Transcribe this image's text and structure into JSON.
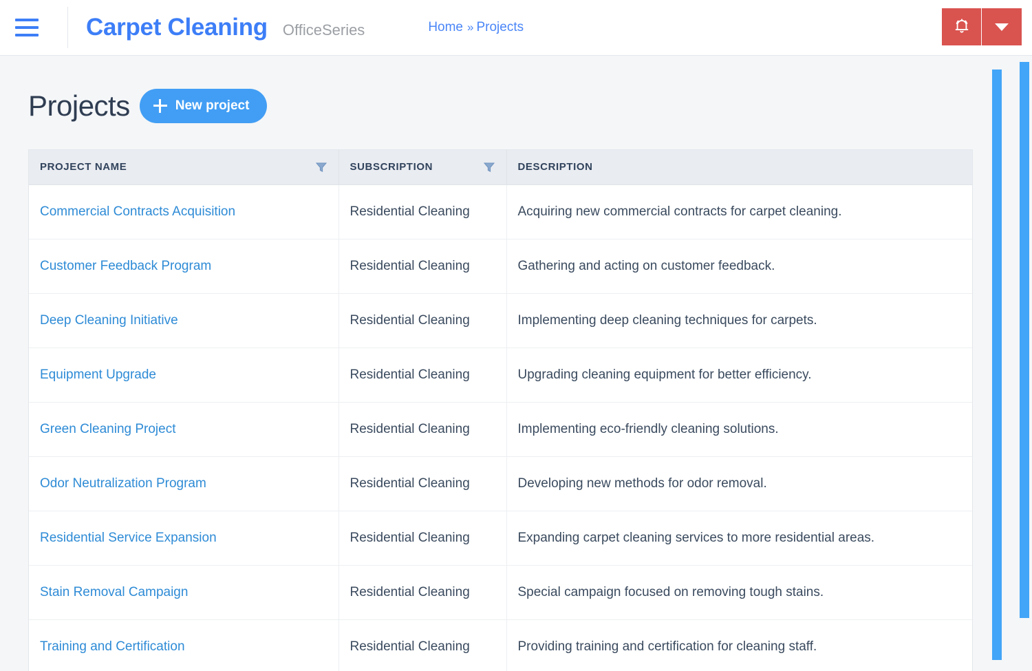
{
  "topbar": {
    "menu_icon": "hamburger-icon",
    "brand_title": "Carpet Cleaning",
    "brand_subtitle": "OfficeSeries",
    "breadcrumb": {
      "home": "Home",
      "separator": "»",
      "current": "Projects"
    },
    "actions": {
      "notification_icon": "bell-icon",
      "dropdown_icon": "chevron-down-icon",
      "accent_color": "#d9534f"
    }
  },
  "page": {
    "title": "Projects",
    "new_project_label": "New project",
    "new_project_icon": "plus-icon",
    "accent_color": "#429ef4"
  },
  "table": {
    "columns": [
      {
        "label": "PROJECT NAME",
        "filterable": true,
        "filter_icon": "filter-icon"
      },
      {
        "label": "SUBSCRIPTION",
        "filterable": true,
        "filter_icon": "filter-icon"
      },
      {
        "label": "DESCRIPTION",
        "filterable": false,
        "filter_icon": ""
      }
    ],
    "rows": [
      {
        "name": "Commercial Contracts Acquisition",
        "subscription": "Residential Cleaning",
        "description": "Acquiring new commercial contracts for carpet cleaning."
      },
      {
        "name": "Customer Feedback Program",
        "subscription": "Residential Cleaning",
        "description": "Gathering and acting on customer feedback."
      },
      {
        "name": "Deep Cleaning Initiative",
        "subscription": "Residential Cleaning",
        "description": "Implementing deep cleaning techniques for carpets."
      },
      {
        "name": "Equipment Upgrade",
        "subscription": "Residential Cleaning",
        "description": "Upgrading cleaning equipment for better efficiency."
      },
      {
        "name": "Green Cleaning Project",
        "subscription": "Residential Cleaning",
        "description": "Implementing eco-friendly cleaning solutions."
      },
      {
        "name": "Odor Neutralization Program",
        "subscription": "Residential Cleaning",
        "description": "Developing new methods for odor removal."
      },
      {
        "name": "Residential Service Expansion",
        "subscription": "Residential Cleaning",
        "description": "Expanding carpet cleaning services to more residential areas."
      },
      {
        "name": "Stain Removal Campaign",
        "subscription": "Residential Cleaning",
        "description": "Special campaign focused on removing tough stains."
      },
      {
        "name": "Training and Certification",
        "subscription": "Residential Cleaning",
        "description": "Providing training and certification for cleaning staff."
      }
    ]
  },
  "scrollbars": {
    "inner": "vertical-scrollbar-inner",
    "outer": "vertical-scrollbar-outer",
    "color": "#42a5f8"
  }
}
